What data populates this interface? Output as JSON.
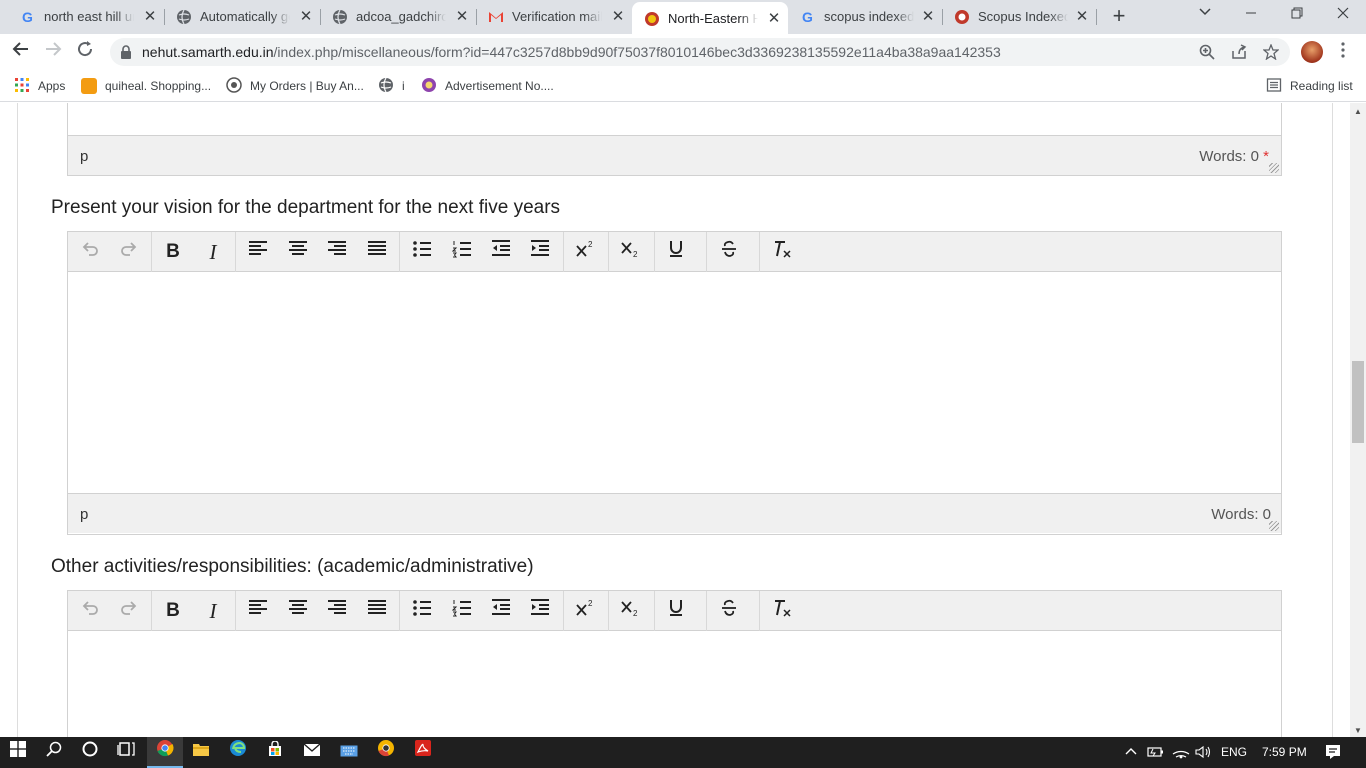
{
  "browser": {
    "tabs": [
      {
        "title": "north east hill uni",
        "favicon": "google-icon"
      },
      {
        "title": "Automatically ge",
        "favicon": "globe-icon"
      },
      {
        "title": "adcoa_gadchiroli",
        "favicon": "globe-icon"
      },
      {
        "title": "Verification mail",
        "favicon": "gmail-icon"
      },
      {
        "title": "North-Eastern Hi",
        "favicon": "nehu-icon",
        "active": true
      },
      {
        "title": "scopus indexed j",
        "favicon": "google-icon"
      },
      {
        "title": "Scopus Indexed",
        "favicon": "scopus-icon"
      }
    ],
    "url_host": "nehut.samarth.edu.in",
    "url_path": "/index.php/miscellaneous/form?id=447c3257d8bb9d90f75037f8010146bec3d3369238135592e11a4ba38a9aa142353",
    "bookmarks": [
      {
        "label": "Apps",
        "icon": "apps-grid-icon"
      },
      {
        "label": "quiheal. Shopping...",
        "icon": "quiheal-icon"
      },
      {
        "label": "My Orders | Buy An...",
        "icon": "orders-icon"
      },
      {
        "label": "i",
        "icon": "globe-icon"
      },
      {
        "label": "Advertisement No....",
        "icon": "advert-icon"
      }
    ],
    "reading_list": "Reading list"
  },
  "form": {
    "top_editor": {
      "path": "p",
      "words": "Words: 0",
      "required": "*"
    },
    "vision": {
      "label": "Present your vision for the department for the next five years",
      "path": "p",
      "words": "Words: 0"
    },
    "other": {
      "label": "Other activities/responsibilities: (academic/administrative)"
    }
  },
  "taskbar": {
    "language": "ENG",
    "time": "7:59 PM"
  }
}
